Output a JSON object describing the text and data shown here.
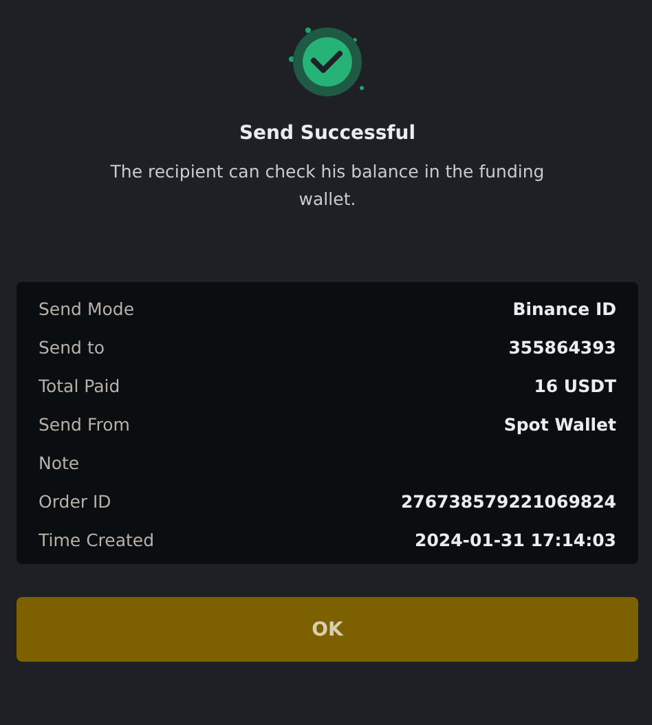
{
  "title": "Send Successful",
  "message": "The recipient can check his balance in the funding wallet.",
  "details": [
    {
      "label": "Send Mode",
      "value": "Binance ID"
    },
    {
      "label": "Send to",
      "value": "355864393"
    },
    {
      "label": "Total Paid",
      "value": "16 USDT"
    },
    {
      "label": "Send From",
      "value": "Spot Wallet"
    },
    {
      "label": "Note"
    },
    {
      "label": "Order ID",
      "value": "276738579221069824"
    },
    {
      "label": "Time Created",
      "value": "2024-01-31 17:14:03"
    }
  ],
  "button": "OK"
}
